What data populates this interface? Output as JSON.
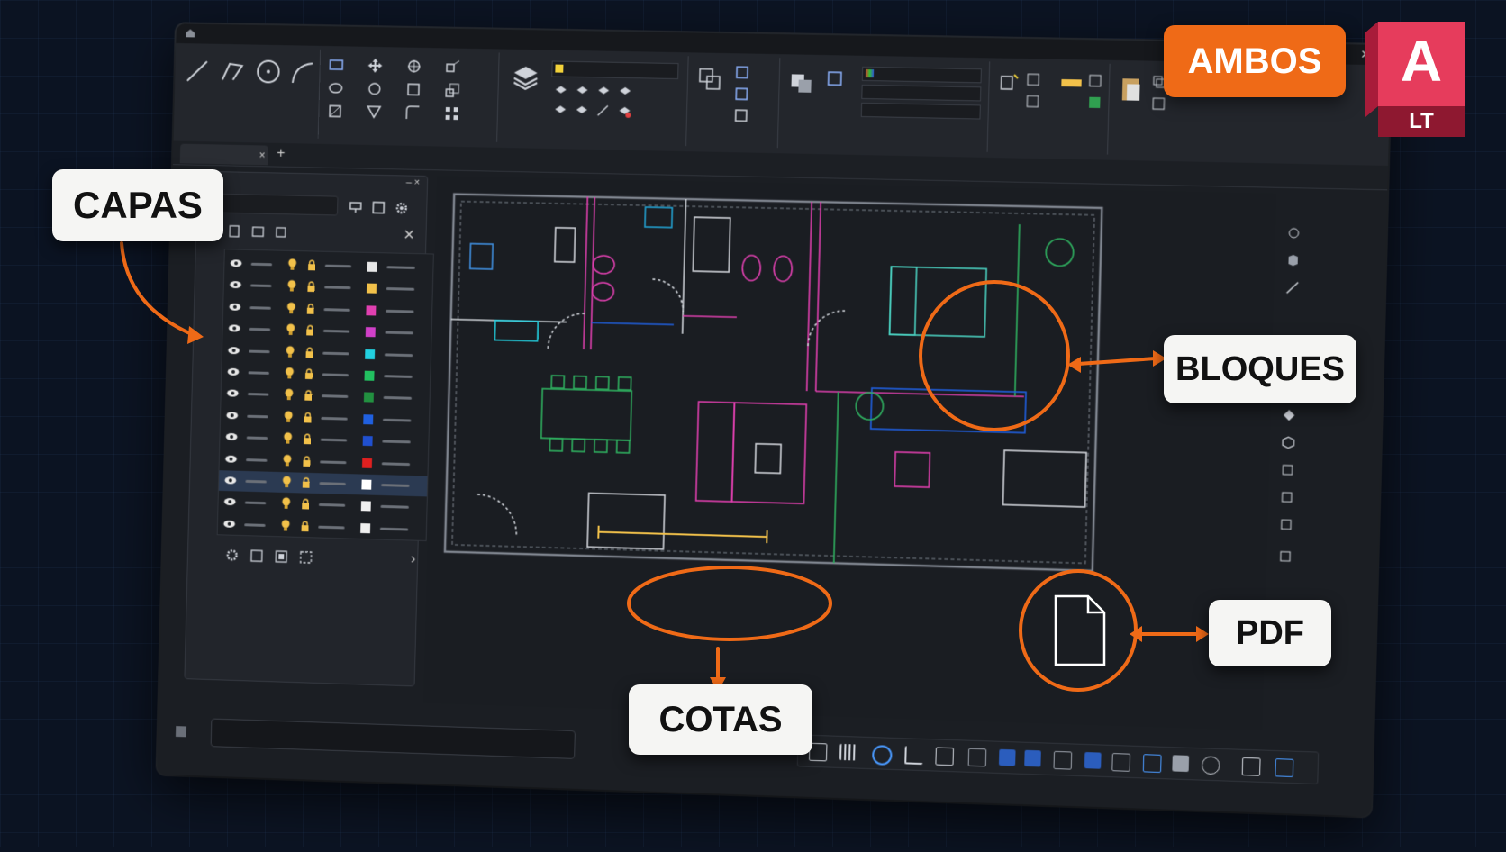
{
  "app": {
    "window_controls": "– ▢ ✕"
  },
  "tabbar": {
    "close": "×",
    "add": "+"
  },
  "layers_panel": {
    "header_controls": "– ×",
    "close": "✕",
    "next": "›",
    "layers": [
      {
        "color": "#e8e8e8",
        "selected": false
      },
      {
        "color": "#f2c14a",
        "selected": false
      },
      {
        "color": "#e040b0",
        "selected": false
      },
      {
        "color": "#d040c8",
        "selected": false
      },
      {
        "color": "#22d0e0",
        "selected": false
      },
      {
        "color": "#22c060",
        "selected": false
      },
      {
        "color": "#229040",
        "selected": false
      },
      {
        "color": "#2060e0",
        "selected": false
      },
      {
        "color": "#2050d0",
        "selected": false
      },
      {
        "color": "#e02020",
        "selected": false
      },
      {
        "color": "#ffffff",
        "selected": true
      },
      {
        "color": "#f0f0f0",
        "selected": false
      },
      {
        "color": "#f0f0f0",
        "selected": false
      }
    ]
  },
  "callouts": {
    "capas": "CAPAS",
    "bloques": "BLOQUES",
    "cotas": "COTAS",
    "pdf": "PDF"
  },
  "badge": {
    "label": "AMBOS"
  },
  "logo": {
    "letter": "A",
    "subtitle": "LT",
    "color": "#d0284a"
  },
  "accent": "#ef6a17"
}
